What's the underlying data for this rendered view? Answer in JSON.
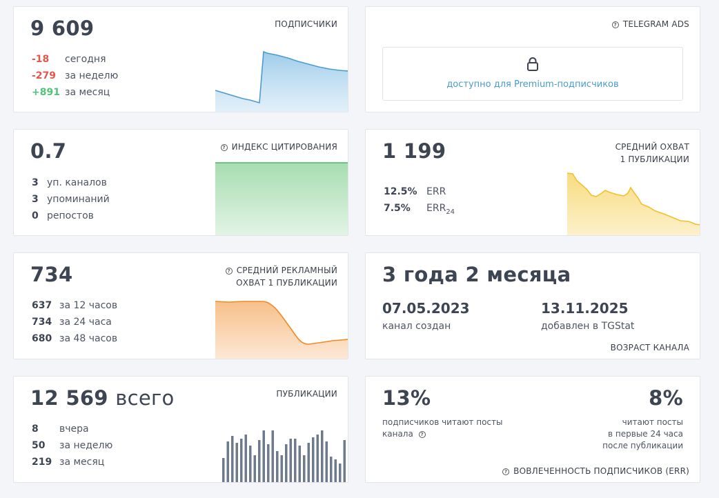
{
  "subscribers": {
    "value": "9 609",
    "title": "ПОДПИСЧИКИ",
    "stats": [
      {
        "value": "-18",
        "label": "сегодня",
        "tone": "negative"
      },
      {
        "value": "-279",
        "label": "за неделю",
        "tone": "negative"
      },
      {
        "value": "+891",
        "label": "за месяц",
        "tone": "positive"
      }
    ],
    "color": "#4a9bcf"
  },
  "telegram_ads": {
    "title": "TELEGRAM ADS",
    "locked_text": "доступно для Premium-подписчиков",
    "link_color": "#4a9bc8"
  },
  "citation": {
    "value": "0.7",
    "title": "ИНДЕКС ЦИТИРОВАНИЯ",
    "stats": [
      {
        "value": "3",
        "label": "уп. каналов"
      },
      {
        "value": "3",
        "label": "упоминаний"
      },
      {
        "value": "0",
        "label": "репостов"
      }
    ],
    "color": "#52b36a"
  },
  "avg_reach": {
    "value": "1 199",
    "title_line1": "СРЕДНИЙ ОХВАТ",
    "title_line2": "1 ПУБЛИКАЦИИ",
    "err": [
      {
        "value": "12.5%",
        "label": "ERR",
        "sub": ""
      },
      {
        "value": "7.5%",
        "label": "ERR",
        "sub": "24"
      }
    ],
    "color": "#f0c030"
  },
  "ad_reach": {
    "value": "734",
    "title_line1": "СРЕДНИЙ РЕКЛАМНЫЙ",
    "title_line2": "ОХВАТ 1 ПУБЛИКАЦИИ",
    "stats": [
      {
        "value": "637",
        "label": "за 12 часов"
      },
      {
        "value": "734",
        "label": "за 24 часа"
      },
      {
        "value": "680",
        "label": "за 48 часов"
      }
    ],
    "color": "#f08a24"
  },
  "channel_age": {
    "value": "3 года 2 месяца",
    "created_date": "07.05.2023",
    "created_label": "канал создан",
    "added_date": "13.11.2025",
    "added_label": "добавлен в TGStat",
    "title": "ВОЗРАСТ КАНАЛА"
  },
  "publications": {
    "total": "12 569",
    "total_suffix": "всего",
    "title": "ПУБЛИКАЦИИ",
    "stats": [
      {
        "value": "8",
        "label": "вчера"
      },
      {
        "value": "50",
        "label": "за неделю"
      },
      {
        "value": "219",
        "label": "за месяц"
      }
    ],
    "color": "#6d7a8c"
  },
  "engagement": {
    "left_value": "13%",
    "left_line1": "подписчиков читают посты",
    "left_line2": "канала",
    "right_value": "8%",
    "right_line1": "читают посты",
    "right_line2": "в первые 24 часа",
    "right_line3": "после публикации",
    "title": "ВОВЛЕЧЕННОСТЬ ПОДПИСЧИКОВ (ERR)"
  }
}
